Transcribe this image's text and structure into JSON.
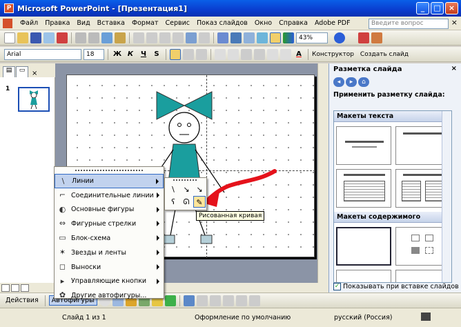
{
  "title_bar": {
    "title": "Microsoft PowerPoint - [Презентация1]",
    "min": "_",
    "max": "□",
    "close": "×"
  },
  "menu": {
    "items": [
      "Файл",
      "Правка",
      "Вид",
      "Вставка",
      "Формат",
      "Сервис",
      "Показ слайдов",
      "Окно",
      "Справка",
      "Adobe PDF"
    ],
    "help_placeholder": "Введите вопрос",
    "close": "×"
  },
  "standard_toolbar": {
    "zoom": "43%"
  },
  "formatting_toolbar": {
    "font": "Arial",
    "size": "18",
    "bold": "Ж",
    "italic": "К",
    "underline": "Ч",
    "shadow": "S",
    "font_color": "A",
    "designer": "Конструктор",
    "new_slide": "Создать слайд"
  },
  "outline_tabs": {
    "slides": "▤",
    "outline": "▭",
    "close": "×"
  },
  "slides_panel": {
    "slide_number": "1"
  },
  "taskpane": {
    "title": "Разметка слайда",
    "close": "×",
    "apply_label": "Применить разметку слайда:",
    "section_text": "Макеты текста",
    "section_content": "Макеты содержимого",
    "show_on_insert": "Показывать при вставке слайдов"
  },
  "autoshapes_menu": {
    "items": [
      {
        "label": "Линии",
        "icon": "\\",
        "submenu": true
      },
      {
        "label": "Соединительные линии",
        "icon": "⌐",
        "submenu": true
      },
      {
        "label": "Основные фигуры",
        "icon": "◐",
        "submenu": true
      },
      {
        "label": "Фигурные стрелки",
        "icon": "⇔",
        "submenu": true
      },
      {
        "label": "Блок-схема",
        "icon": "▭",
        "submenu": true
      },
      {
        "label": "Звезды и ленты",
        "icon": "✶",
        "submenu": true
      },
      {
        "label": "Выноски",
        "icon": "◻",
        "submenu": true
      },
      {
        "label": "Управляющие кнопки",
        "icon": "▸",
        "submenu": true
      },
      {
        "label": "Другие автофигуры...",
        "icon": "✿",
        "submenu": false
      }
    ]
  },
  "lines_submenu": {
    "cells": [
      "\\",
      "↘",
      "↘",
      "ʕ",
      "ᘏ",
      "✎"
    ],
    "tooltip": "Рисованная кривая"
  },
  "drawing_toolbar": {
    "actions": "Действия",
    "autoshapes": "Автофигуры"
  },
  "status_bar": {
    "slide": "Слайд 1 из 1",
    "design": "Оформление по умолчанию",
    "language": "русский (Россия)"
  },
  "colors": {
    "figure": "#1a9e9e",
    "arrow": "#e5121b",
    "selection": "#c1d2ee"
  }
}
